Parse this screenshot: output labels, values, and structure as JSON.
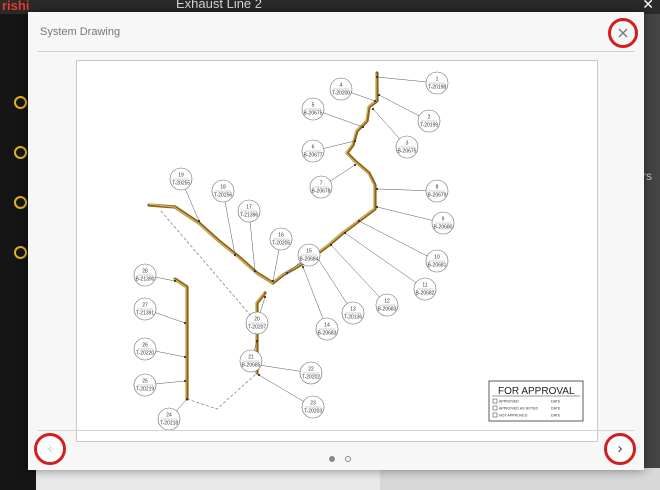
{
  "background": {
    "brand": "rishi",
    "window_title": "Exhaust Line 2",
    "top_right": "✕",
    "right_panel_text": "rs"
  },
  "modal": {
    "title": "System Drawing",
    "close_icon": "close-icon",
    "prev_icon": "chevron-left-icon",
    "next_icon": "chevron-right-icon",
    "prev_label": "‹",
    "next_label": "›",
    "page_count": 2,
    "current_page": 1,
    "highlight_color": "#d21e1e"
  },
  "drawing": {
    "callouts": [
      {
        "num": "1",
        "code": "T-20198"
      },
      {
        "num": "2",
        "code": "T-20199"
      },
      {
        "num": "3",
        "code": "B-20675"
      },
      {
        "num": "4",
        "code": "T-20200"
      },
      {
        "num": "5",
        "code": "B-20675"
      },
      {
        "num": "6",
        "code": "B-20677"
      },
      {
        "num": "7",
        "code": "B-20678"
      },
      {
        "num": "8",
        "code": "B-20679"
      },
      {
        "num": "9",
        "code": "B-20680"
      },
      {
        "num": "10",
        "code": "B-20681"
      },
      {
        "num": "11",
        "code": "B-20682"
      },
      {
        "num": "12",
        "code": "B-20683"
      },
      {
        "num": "13",
        "code": "T-20136"
      },
      {
        "num": "14",
        "code": "B-20683"
      },
      {
        "num": "15",
        "code": "B-20684"
      },
      {
        "num": "16",
        "code": "T-20205"
      },
      {
        "num": "17",
        "code": "T-21396"
      },
      {
        "num": "18",
        "code": "T-20256"
      },
      {
        "num": "19",
        "code": "T-20255"
      },
      {
        "num": "20",
        "code": "T-20207"
      },
      {
        "num": "21",
        "code": "B-20685"
      },
      {
        "num": "22",
        "code": "T-20202"
      },
      {
        "num": "23",
        "code": "T-20203"
      },
      {
        "num": "24",
        "code": "T-20218"
      },
      {
        "num": "25",
        "code": "T-20219"
      },
      {
        "num": "26",
        "code": "T-20220"
      },
      {
        "num": "27",
        "code": "T-21391"
      },
      {
        "num": "28",
        "code": "B-21390"
      }
    ],
    "approval": {
      "title": "FOR APPROVAL",
      "options": [
        "APPROVED",
        "APPROVED AS NOTED",
        "NOT APPROVED"
      ],
      "date_label": "DATE"
    }
  }
}
